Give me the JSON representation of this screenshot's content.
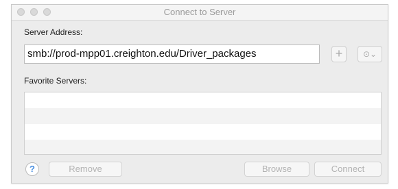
{
  "window": {
    "title": "Connect to Server"
  },
  "server_address": {
    "label": "Server Address:",
    "value": "smb://prod-mpp01.creighton.edu/Driver_packages"
  },
  "address_buttons": {
    "add_label": "+",
    "recent_label": "⊙⌄"
  },
  "favorites": {
    "label": "Favorite Servers:",
    "items": []
  },
  "footer": {
    "help_label": "?",
    "remove_label": "Remove",
    "browse_label": "Browse",
    "connect_label": "Connect"
  },
  "colors": {
    "window_background": "#ececec",
    "disabled_text": "#b3b3b3",
    "help_blue": "#4a8fe0"
  },
  "icons": {
    "add": "plus-icon",
    "recent": "clock-icon",
    "help": "question-icon"
  }
}
